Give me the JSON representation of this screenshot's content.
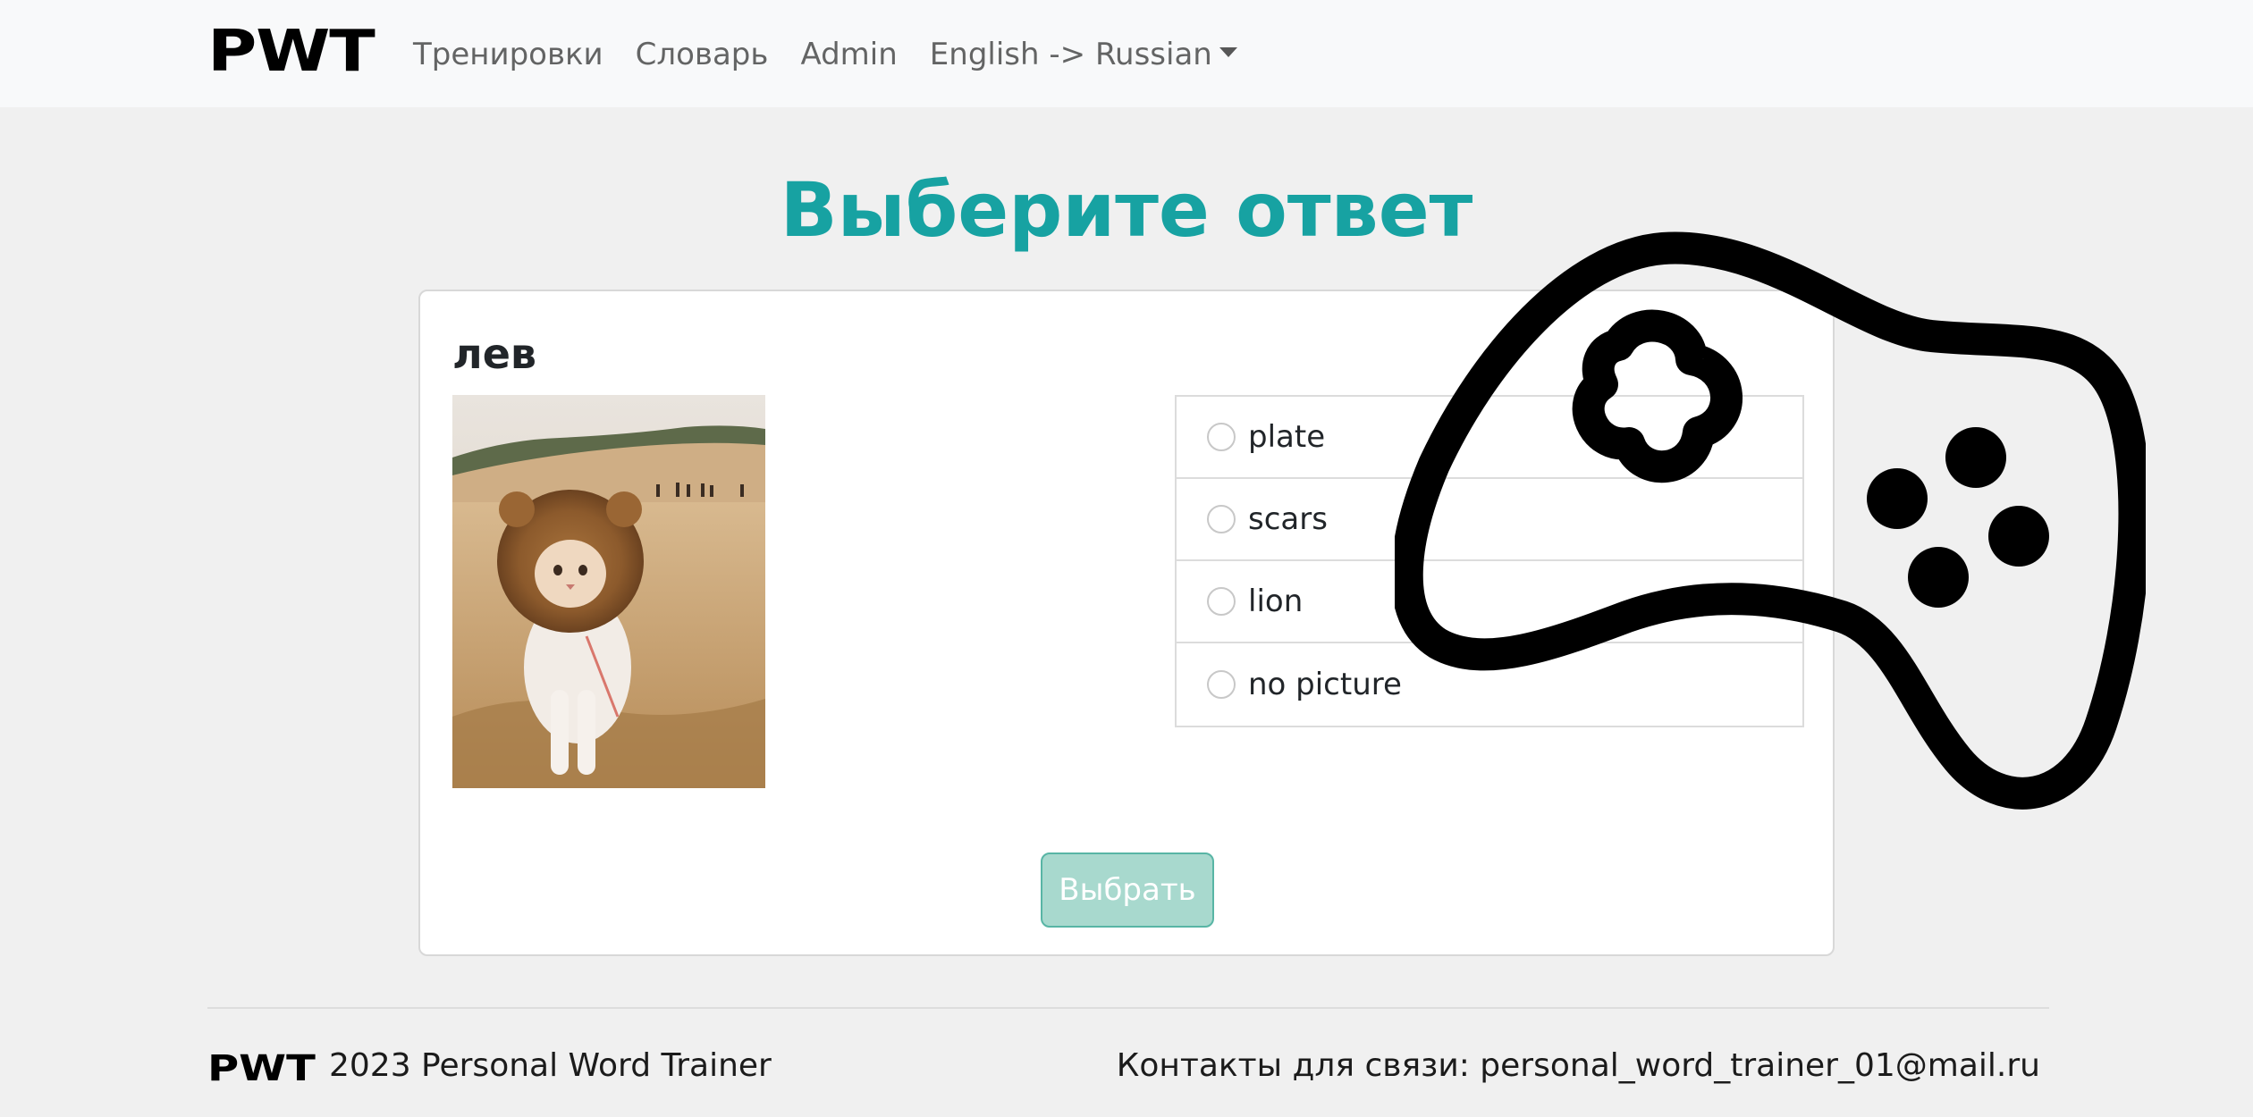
{
  "navbar": {
    "brand": "PWT",
    "links": [
      "Тренировки",
      "Словарь",
      "Admin"
    ],
    "language_dropdown": "English -> Russian"
  },
  "page": {
    "title": "Выберите ответ"
  },
  "question": {
    "word": "лев",
    "picture_icon": "cat-in-lion-mane-photo",
    "options": [
      "plate",
      "scars",
      "lion",
      "no picture"
    ],
    "selected": null,
    "submit_label": "Выбрать"
  },
  "overlay": {
    "icon": "gamepad-icon"
  },
  "footer": {
    "brand": "PWT",
    "copyright": "2023 Personal Word Trainer",
    "contacts": "Контакты для связи: personal_word_trainer_01@mail.ru"
  },
  "colors": {
    "accent": "#17a2a2",
    "button_bg": "#a8d9ce",
    "button_border": "#58b5a5",
    "page_bg": "#f0f0f0"
  }
}
